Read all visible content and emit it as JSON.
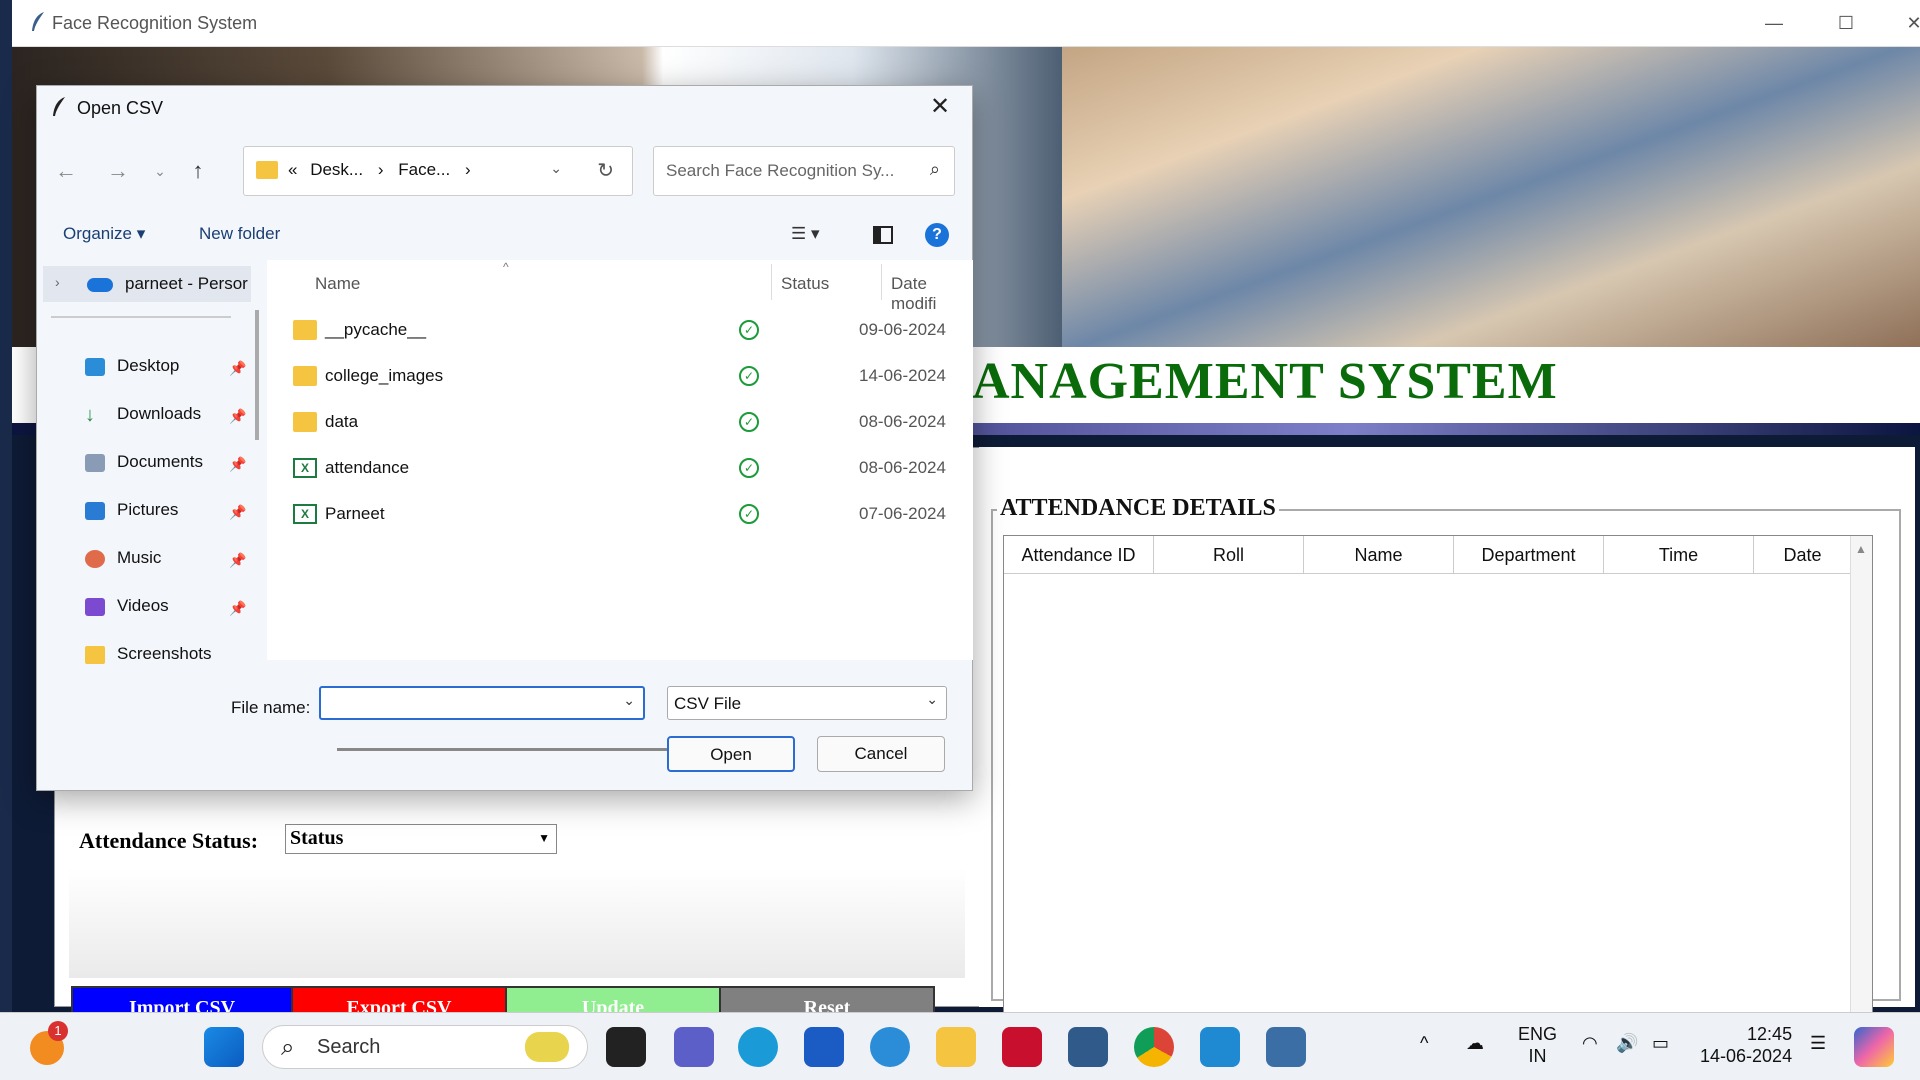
{
  "window": {
    "title": "Face Recognition System"
  },
  "app": {
    "heading": "ANAGEMENT SYSTEM",
    "attendance_group_label": "ATTENDANCE DETAILS",
    "table_columns": [
      "Attendance ID",
      "Roll",
      "Name",
      "Department",
      "Time",
      "Date"
    ],
    "status_label": "Attendance Status:",
    "status_value": "Status",
    "buttons": {
      "import": "Import CSV",
      "export": "Export CSV",
      "update": "Update",
      "reset": "Reset"
    },
    "button_colors": {
      "import": "#0000ff",
      "export": "#ff0000",
      "update": "#90ee90",
      "reset": "#808080"
    }
  },
  "dialog": {
    "title": "Open CSV",
    "address": [
      "«",
      "Desk...",
      "›",
      "Face...",
      "›"
    ],
    "search_placeholder": "Search Face Recognition Sy...",
    "organize": "Organize",
    "new_folder": "New folder",
    "nav": {
      "onedrive": "parneet - Persor",
      "items": [
        "Desktop",
        "Downloads",
        "Documents",
        "Pictures",
        "Music",
        "Videos",
        "Screenshots"
      ]
    },
    "columns": {
      "name": "Name",
      "status": "Status",
      "date": "Date modifi"
    },
    "files": [
      {
        "name": "__pycache__",
        "type": "folder",
        "date": "09-06-2024"
      },
      {
        "name": "college_images",
        "type": "folder",
        "date": "14-06-2024"
      },
      {
        "name": "data",
        "type": "folder",
        "date": "08-06-2024"
      },
      {
        "name": "attendance",
        "type": "excel",
        "date": "08-06-2024"
      },
      {
        "name": "Parneet",
        "type": "excel",
        "date": "07-06-2024"
      }
    ],
    "file_name_label": "File name:",
    "file_name_value": "",
    "file_type": "CSV File",
    "open_button": "Open",
    "cancel_button": "Cancel"
  },
  "taskbar": {
    "search_label": "Search",
    "notification_count": "1",
    "lang_top": "ENG",
    "lang_bottom": "IN",
    "time": "12:45",
    "date": "14-06-2024"
  }
}
